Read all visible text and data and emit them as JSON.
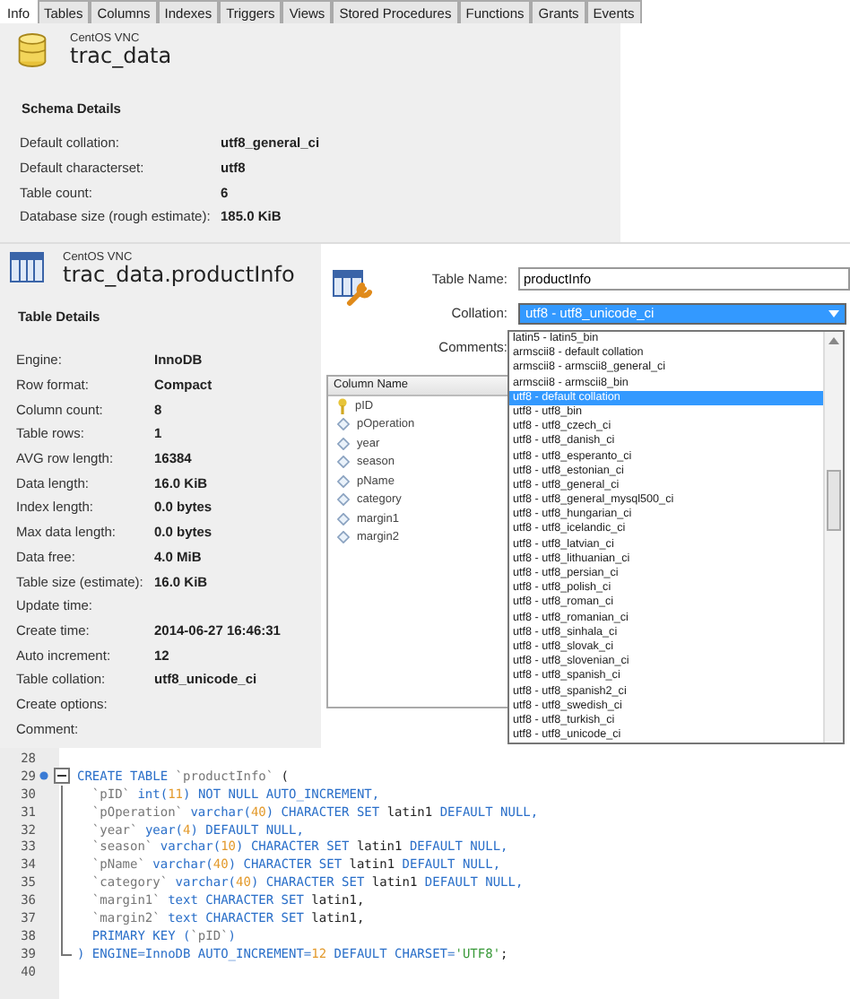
{
  "tabs": [
    {
      "label": "Info",
      "selected": true
    },
    {
      "label": "Tables",
      "selected": false
    },
    {
      "label": "Columns",
      "selected": false
    },
    {
      "label": "Indexes",
      "selected": false
    },
    {
      "label": "Triggers",
      "selected": false
    },
    {
      "label": "Views",
      "selected": false
    },
    {
      "label": "Stored Procedures",
      "selected": false
    },
    {
      "label": "Functions",
      "selected": false
    },
    {
      "label": "Grants",
      "selected": false
    },
    {
      "label": "Events",
      "selected": false
    }
  ],
  "schema": {
    "server": "CentOS VNC",
    "name": "trac_data",
    "section_title": "Schema Details",
    "details": [
      {
        "label": "Default collation:",
        "value": "utf8_general_ci"
      },
      {
        "label": "Default characterset:",
        "value": "utf8"
      },
      {
        "label": "Table count:",
        "value": "6"
      },
      {
        "label": "Database size (rough estimate):",
        "value": "185.0 KiB"
      }
    ]
  },
  "table_info": {
    "server": "CentOS VNC",
    "name": "trac_data.productInfo",
    "section_title": "Table Details",
    "details": [
      {
        "label": "Engine:",
        "value": "InnoDB"
      },
      {
        "label": "Row format:",
        "value": "Compact"
      },
      {
        "label": "Column count:",
        "value": "8"
      },
      {
        "label": "Table rows:",
        "value": "1"
      },
      {
        "label": "AVG row length:",
        "value": "16384"
      },
      {
        "label": "Data length:",
        "value": "16.0 KiB"
      },
      {
        "label": "Index length:",
        "value": "0.0 bytes"
      },
      {
        "label": "Max data length:",
        "value": "0.0 bytes"
      },
      {
        "label": "Data free:",
        "value": "4.0 MiB"
      },
      {
        "label": "Table size (estimate):",
        "value": "16.0 KiB"
      },
      {
        "label": "Update time:"
      },
      {
        "label": "Create time:",
        "value": "2014-06-27 16:46:31"
      },
      {
        "label": "Auto increment:",
        "value": "12"
      },
      {
        "label": "Table collation:",
        "value": "utf8_unicode_ci"
      },
      {
        "label": "Create options:"
      },
      {
        "label": "Comment:"
      }
    ]
  },
  "table_editor": {
    "table_name_label": "Table Name:",
    "table_name": "productInfo",
    "collation_label": "Collation:",
    "collation": "utf8 - utf8_unicode_ci",
    "comments_label": "Comments:",
    "collation_options": [
      {
        "label": "latin5 - latin5_bin",
        "selected": false
      },
      {
        "label": "armscii8 - default collation",
        "selected": false
      },
      {
        "label": "armscii8 - armscii8_general_ci",
        "selected": false
      },
      {
        "label": "armscii8 - armscii8_bin",
        "selected": false
      },
      {
        "label": "utf8 - default collation",
        "selected": true
      },
      {
        "label": "utf8 - utf8_bin",
        "selected": false
      },
      {
        "label": "utf8 - utf8_czech_ci",
        "selected": false
      },
      {
        "label": "utf8 - utf8_danish_ci",
        "selected": false
      },
      {
        "label": "utf8 - utf8_esperanto_ci",
        "selected": false
      },
      {
        "label": "utf8 - utf8_estonian_ci",
        "selected": false
      },
      {
        "label": "utf8 - utf8_general_ci",
        "selected": false
      },
      {
        "label": "utf8 - utf8_general_mysql500_ci",
        "selected": false
      },
      {
        "label": "utf8 - utf8_hungarian_ci",
        "selected": false
      },
      {
        "label": "utf8 - utf8_icelandic_ci",
        "selected": false
      },
      {
        "label": "utf8 - utf8_latvian_ci",
        "selected": false
      },
      {
        "label": "utf8 - utf8_lithuanian_ci",
        "selected": false
      },
      {
        "label": "utf8 - utf8_persian_ci",
        "selected": false
      },
      {
        "label": "utf8 - utf8_polish_ci",
        "selected": false
      },
      {
        "label": "utf8 - utf8_roman_ci",
        "selected": false
      },
      {
        "label": "utf8 - utf8_romanian_ci",
        "selected": false
      },
      {
        "label": "utf8 - utf8_sinhala_ci",
        "selected": false
      },
      {
        "label": "utf8 - utf8_slovak_ci",
        "selected": false
      },
      {
        "label": "utf8 - utf8_slovenian_ci",
        "selected": false
      },
      {
        "label": "utf8 - utf8_spanish_ci",
        "selected": false
      },
      {
        "label": "utf8 - utf8_spanish2_ci",
        "selected": false
      },
      {
        "label": "utf8 - utf8_swedish_ci",
        "selected": false
      },
      {
        "label": "utf8 - utf8_turkish_ci",
        "selected": false
      },
      {
        "label": "utf8 - utf8_unicode_ci",
        "selected": false
      }
    ],
    "columns_header": "Column Name",
    "columns": [
      {
        "name": "pID",
        "kind": "primary_key"
      },
      {
        "name": "pOperation",
        "kind": "column"
      },
      {
        "name": "year",
        "kind": "column"
      },
      {
        "name": "season",
        "kind": "column"
      },
      {
        "name": "pName",
        "kind": "column"
      },
      {
        "name": "category",
        "kind": "column"
      },
      {
        "name": "margin1",
        "kind": "column"
      },
      {
        "name": "margin2",
        "kind": "column"
      }
    ]
  },
  "code": {
    "lines": [
      {
        "number": "28",
        "bookmark": false,
        "kind": "plain"
      },
      {
        "number": "29",
        "bookmark": true,
        "kind": "fold_start",
        "segments": [
          {
            "t": "CREATE TABLE ",
            "kind": "keyword"
          },
          {
            "t": "`productInfo`",
            "kind": "identifier"
          },
          {
            "t": " (",
            "kind": "plain"
          }
        ]
      },
      {
        "number": "30",
        "bookmark": false,
        "kind": "fold_body",
        "segments": [
          {
            "t": "  `pID` ",
            "kind": "identifier"
          },
          {
            "t": "int(",
            "kind": "keyword"
          },
          {
            "t": "11",
            "kind": "number"
          },
          {
            "t": ") NOT NULL AUTO_INCREMENT,",
            "kind": "keyword"
          }
        ]
      },
      {
        "number": "31",
        "bookmark": false,
        "kind": "fold_body",
        "segments": [
          {
            "t": "  `pOperation` ",
            "kind": "identifier"
          },
          {
            "t": "varchar(",
            "kind": "keyword"
          },
          {
            "t": "40",
            "kind": "number"
          },
          {
            "t": ") CHARACTER SET ",
            "kind": "keyword"
          },
          {
            "t": "latin1 ",
            "kind": "plain"
          },
          {
            "t": "DEFAULT NULL,",
            "kind": "keyword"
          }
        ]
      },
      {
        "number": "32",
        "bookmark": false,
        "kind": "fold_body",
        "segments": [
          {
            "t": "  `year` ",
            "kind": "identifier"
          },
          {
            "t": "year(",
            "kind": "keyword"
          },
          {
            "t": "4",
            "kind": "number"
          },
          {
            "t": ") DEFAULT NULL,",
            "kind": "keyword"
          }
        ]
      },
      {
        "number": "33",
        "bookmark": false,
        "kind": "fold_body",
        "segments": [
          {
            "t": "  `season` ",
            "kind": "identifier"
          },
          {
            "t": "varchar(",
            "kind": "keyword"
          },
          {
            "t": "10",
            "kind": "number"
          },
          {
            "t": ") CHARACTER SET ",
            "kind": "keyword"
          },
          {
            "t": "latin1 ",
            "kind": "plain"
          },
          {
            "t": "DEFAULT NULL,",
            "kind": "keyword"
          }
        ]
      },
      {
        "number": "34",
        "bookmark": false,
        "kind": "fold_body",
        "segments": [
          {
            "t": "  `pName` ",
            "kind": "identifier"
          },
          {
            "t": "varchar(",
            "kind": "keyword"
          },
          {
            "t": "40",
            "kind": "number"
          },
          {
            "t": ") CHARACTER SET ",
            "kind": "keyword"
          },
          {
            "t": "latin1 ",
            "kind": "plain"
          },
          {
            "t": "DEFAULT NULL,",
            "kind": "keyword"
          }
        ]
      },
      {
        "number": "35",
        "bookmark": false,
        "kind": "fold_body",
        "segments": [
          {
            "t": "  `category` ",
            "kind": "identifier"
          },
          {
            "t": "varchar(",
            "kind": "keyword"
          },
          {
            "t": "40",
            "kind": "number"
          },
          {
            "t": ") CHARACTER SET ",
            "kind": "keyword"
          },
          {
            "t": "latin1 ",
            "kind": "plain"
          },
          {
            "t": "DEFAULT NULL,",
            "kind": "keyword"
          }
        ]
      },
      {
        "number": "36",
        "bookmark": false,
        "kind": "fold_body",
        "segments": [
          {
            "t": "  `margin1` ",
            "kind": "identifier"
          },
          {
            "t": "text CHARACTER SET ",
            "kind": "keyword"
          },
          {
            "t": "latin1,",
            "kind": "plain"
          }
        ]
      },
      {
        "number": "37",
        "bookmark": false,
        "kind": "fold_body",
        "segments": [
          {
            "t": "  `margin2` ",
            "kind": "identifier"
          },
          {
            "t": "text CHARACTER SET ",
            "kind": "keyword"
          },
          {
            "t": "latin1,",
            "kind": "plain"
          }
        ]
      },
      {
        "number": "38",
        "bookmark": false,
        "kind": "fold_body",
        "segments": [
          {
            "t": "  PRIMARY KEY (",
            "kind": "keyword"
          },
          {
            "t": "`pID`",
            "kind": "identifier"
          },
          {
            "t": ")",
            "kind": "keyword"
          }
        ]
      },
      {
        "number": "39",
        "bookmark": false,
        "kind": "fold_end",
        "segments": [
          {
            "t": ") ENGINE=InnoDB AUTO_INCREMENT=",
            "kind": "keyword"
          },
          {
            "t": "12",
            "kind": "number"
          },
          {
            "t": " DEFAULT CHARSET=",
            "kind": "keyword"
          },
          {
            "t": "'UTF8'",
            "kind": "string"
          },
          {
            "t": ";",
            "kind": "plain"
          }
        ]
      },
      {
        "number": "40",
        "bookmark": false,
        "kind": "plain"
      }
    ]
  }
}
